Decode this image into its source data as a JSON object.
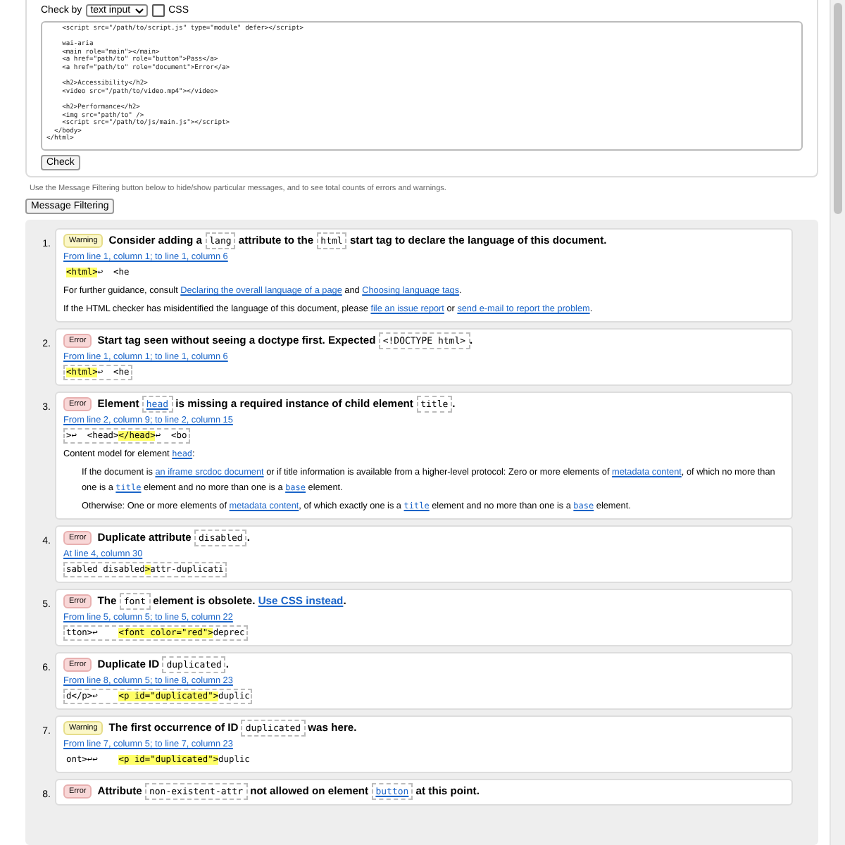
{
  "check_by": {
    "label": "Check by",
    "select": "text input",
    "css_checkbox": {
      "label": "CSS",
      "checked": false
    }
  },
  "source": "    <script src=\"/path/to/script.js\" type=\"module\" defer></script>\n\n    wai-aria\n    <main role=\"main\"></main>\n    <a href=\"path/to\" role=\"button\">Pass</a>\n    <a href=\"path/to\" role=\"document\">Error</a>\n\n    <h2>Accessibility</h2>\n    <video src=\"/path/to/video.mp4\"></video>\n\n    <h2>Performance</h2>\n    <img src=\"path/to\" />\n    <script src=\"/path/to/js/main.js\"></script>\n  </body>\n</html>",
  "check_button": "Check",
  "filter_hint": "Use the Message Filtering button below to hide/show particular messages, and to see total counts of errors and warnings.",
  "filter_button": "Message Filtering",
  "messages": [
    {
      "number": "1.",
      "kind": "warning",
      "badge": "Warning",
      "title": [
        {
          "kind": "text",
          "s": "Consider adding a "
        },
        {
          "kind": "code",
          "s": "lang"
        },
        {
          "kind": "text",
          "s": " attribute to the "
        },
        {
          "kind": "code",
          "s": "html"
        },
        {
          "kind": "text",
          "s": " start tag to declare the language of this document."
        }
      ],
      "location": "From line 1, column 1; to line 1, column 6",
      "extract_boxed": false,
      "extract": [
        {
          "s": "<html>",
          "highlight": true
        },
        {
          "s": "↩  <he",
          "highlight": false
        }
      ],
      "notes": [
        {
          "indent": false,
          "parts": [
            {
              "kind": "text",
              "s": "For further guidance, consult "
            },
            {
              "kind": "link",
              "s": "Declaring the overall language of a page"
            },
            {
              "kind": "text",
              "s": " and "
            },
            {
              "kind": "link",
              "s": "Choosing language tags"
            },
            {
              "kind": "text",
              "s": "."
            }
          ]
        },
        {
          "indent": false,
          "parts": [
            {
              "kind": "text",
              "s": "If the HTML checker has misidentified the language of this document, please "
            },
            {
              "kind": "link",
              "s": "file an issue report"
            },
            {
              "kind": "text",
              "s": " or "
            },
            {
              "kind": "link",
              "s": "send e-mail to report the problem"
            },
            {
              "kind": "text",
              "s": "."
            }
          ]
        }
      ]
    },
    {
      "number": "2.",
      "kind": "error",
      "badge": "Error",
      "title": [
        {
          "kind": "text",
          "s": "Start tag seen without seeing a doctype first. Expected "
        },
        {
          "kind": "code",
          "s": "<!DOCTYPE html>"
        },
        {
          "kind": "text",
          "s": "."
        }
      ],
      "location": "From line 1, column 1; to line 1, column 6",
      "extract_boxed": true,
      "extract": [
        {
          "s": "<html>",
          "highlight": true
        },
        {
          "s": "↩  <he",
          "highlight": false
        }
      ]
    },
    {
      "number": "3.",
      "kind": "error",
      "badge": "Error",
      "title": [
        {
          "kind": "text",
          "s": "Element "
        },
        {
          "kind": "code_link",
          "s": "head"
        },
        {
          "kind": "text",
          "s": " is missing a required instance of child element "
        },
        {
          "kind": "code",
          "s": "title"
        },
        {
          "kind": "text",
          "s": "."
        }
      ],
      "location": "From line 2, column 9; to line 2, column 15",
      "extract_boxed": true,
      "extract": [
        {
          "s": ">↩  <head>",
          "highlight": false
        },
        {
          "s": "</head>",
          "highlight": true
        },
        {
          "s": "↩  <bo",
          "highlight": false
        }
      ],
      "notes": [
        {
          "indent": false,
          "parts": [
            {
              "kind": "text",
              "s": "Content model for element "
            },
            {
              "kind": "mono_link",
              "s": "head"
            },
            {
              "kind": "text",
              "s": ":"
            }
          ]
        },
        {
          "indent": true,
          "parts": [
            {
              "kind": "text",
              "s": "If the document is "
            },
            {
              "kind": "link",
              "s": "an iframe srcdoc document"
            },
            {
              "kind": "text",
              "s": " or if title information is available from a higher-level protocol: Zero or more elements of "
            },
            {
              "kind": "link",
              "s": "metadata content"
            },
            {
              "kind": "text",
              "s": ", of which no more than one is a "
            },
            {
              "kind": "mono_link",
              "s": "title"
            },
            {
              "kind": "text",
              "s": " element and no more than one is a "
            },
            {
              "kind": "mono_link",
              "s": "base"
            },
            {
              "kind": "text",
              "s": " element."
            }
          ]
        },
        {
          "indent": true,
          "parts": [
            {
              "kind": "text",
              "s": "Otherwise: One or more elements of "
            },
            {
              "kind": "link",
              "s": "metadata content"
            },
            {
              "kind": "text",
              "s": ", of which exactly one is a "
            },
            {
              "kind": "mono_link",
              "s": "title"
            },
            {
              "kind": "text",
              "s": " element and no more than one is a "
            },
            {
              "kind": "mono_link",
              "s": "base"
            },
            {
              "kind": "text",
              "s": " element."
            }
          ]
        }
      ]
    },
    {
      "number": "4.",
      "kind": "error",
      "badge": "Error",
      "title": [
        {
          "kind": "text",
          "s": "Duplicate attribute "
        },
        {
          "kind": "code",
          "s": "disabled"
        },
        {
          "kind": "text",
          "s": "."
        }
      ],
      "location": "At line 4, column 30",
      "extract_boxed": true,
      "extract": [
        {
          "s": "sabled disabled",
          "highlight": false
        },
        {
          "s": ">",
          "highlight": true
        },
        {
          "s": "attr-duplicati",
          "highlight": false
        }
      ]
    },
    {
      "number": "5.",
      "kind": "error",
      "badge": "Error",
      "title": [
        {
          "kind": "text",
          "s": "The "
        },
        {
          "kind": "code",
          "s": "font"
        },
        {
          "kind": "text",
          "s": " element is obsolete. "
        },
        {
          "kind": "strong_link",
          "s": "Use CSS instead"
        },
        {
          "kind": "text",
          "s": "."
        }
      ],
      "location": "From line 5, column 5; to line 5, column 22",
      "extract_boxed": true,
      "extract": [
        {
          "s": "tton>↩    ",
          "highlight": false
        },
        {
          "s": "<font color=\"red\">",
          "highlight": true
        },
        {
          "s": "deprec",
          "highlight": false
        }
      ]
    },
    {
      "number": "6.",
      "kind": "error",
      "badge": "Error",
      "title": [
        {
          "kind": "text",
          "s": "Duplicate ID "
        },
        {
          "kind": "code",
          "s": "duplicated"
        },
        {
          "kind": "text",
          "s": "."
        }
      ],
      "location": "From line 8, column 5; to line 8, column 23",
      "extract_boxed": true,
      "extract": [
        {
          "s": "d</p>↩    ",
          "highlight": false
        },
        {
          "s": "<p id=\"duplicated\">",
          "highlight": true
        },
        {
          "s": "duplic",
          "highlight": false
        }
      ]
    },
    {
      "number": "7.",
      "kind": "warning",
      "badge": "Warning",
      "title": [
        {
          "kind": "text",
          "s": "The first occurrence of ID "
        },
        {
          "kind": "code",
          "s": "duplicated"
        },
        {
          "kind": "text",
          "s": " was here."
        }
      ],
      "location": "From line 7, column 5; to line 7, column 23",
      "extract_boxed": false,
      "extract": [
        {
          "s": "ont>↩↩    ",
          "highlight": false
        },
        {
          "s": "<p id=\"duplicated\">",
          "highlight": true
        },
        {
          "s": "duplic",
          "highlight": false
        }
      ]
    },
    {
      "number": "8.",
      "kind": "error",
      "badge": "Error",
      "title": [
        {
          "kind": "text",
          "s": "Attribute "
        },
        {
          "kind": "code",
          "s": "non-existent-attr"
        },
        {
          "kind": "text",
          "s": " not allowed on element "
        },
        {
          "kind": "code_link",
          "s": "button"
        },
        {
          "kind": "text",
          "s": " at this point."
        }
      ]
    }
  ]
}
